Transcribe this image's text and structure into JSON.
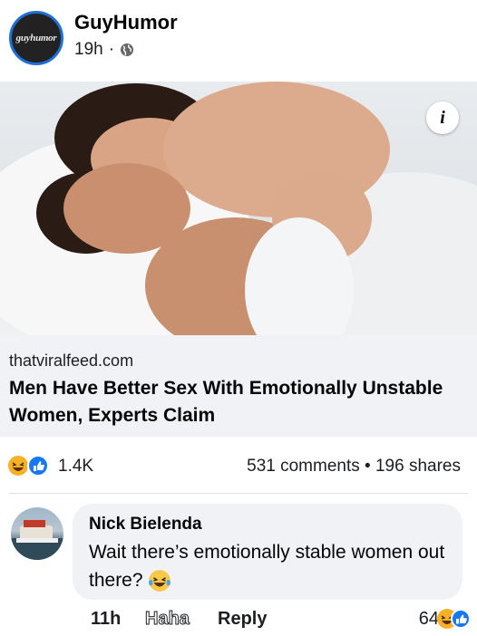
{
  "post": {
    "page_name": "GuyHumor",
    "avatar_text": "guyhumor",
    "time": "19h",
    "separator": "·",
    "privacy_icon": "globe-icon"
  },
  "image": {
    "info_label": "i"
  },
  "link": {
    "domain": "thatviralfeed.com",
    "headline": "Men Have Better Sex With Emotionally Unstable Women, Experts Claim"
  },
  "stats": {
    "reaction_icons": [
      "haha-icon",
      "like-icon"
    ],
    "reactions_count": "1.4K",
    "comments": "531 comments",
    "dot": "•",
    "shares": "196 shares"
  },
  "comment": {
    "author": "Nick Bielenda",
    "text": "Wait there’s emotionally stable women out there?",
    "emoji": "laughing-tears-emoji",
    "time": "11h",
    "haha_label": "Haha",
    "reply_label": "Reply",
    "reactions_count": "64"
  },
  "colors": {
    "accent": "#1877f2",
    "haha": "#f7b125",
    "bubble": "#f0f2f5"
  }
}
